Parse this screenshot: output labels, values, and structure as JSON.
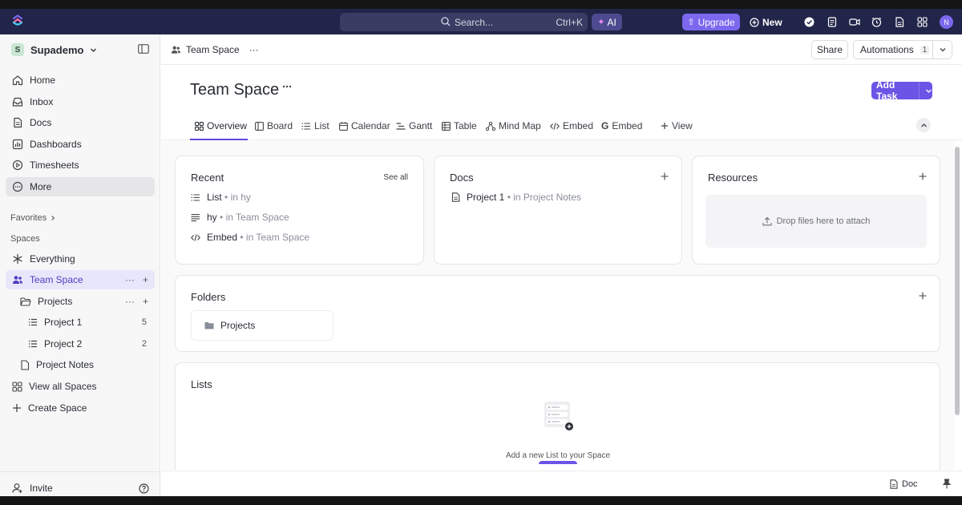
{
  "topbar": {
    "search_placeholder": "Search...",
    "search_shortcut": "Ctrl+K",
    "ai_label": "AI",
    "upgrade_label": "Upgrade",
    "new_label": "New",
    "avatar_initial": "N",
    "colors": {
      "bar": "#22254a",
      "accent": "#7b68ee"
    }
  },
  "sidebar": {
    "workspace_initial": "S",
    "workspace_name": "Supademo",
    "nav": [
      {
        "label": "Home",
        "icon": "home-icon"
      },
      {
        "label": "Inbox",
        "icon": "inbox-icon"
      },
      {
        "label": "Docs",
        "icon": "docs-icon"
      },
      {
        "label": "Dashboards",
        "icon": "dashboards-icon"
      },
      {
        "label": "Timesheets",
        "icon": "timesheets-icon"
      },
      {
        "label": "More",
        "icon": "more-icon"
      }
    ],
    "favorites_label": "Favorites",
    "spaces_label": "Spaces",
    "spaces": [
      {
        "label": "Everything",
        "icon": "everything-icon"
      },
      {
        "label": "Team Space",
        "icon": "team-icon"
      },
      {
        "label": "Projects",
        "icon": "folder-open-icon"
      },
      {
        "label": "Project 1",
        "count": "5",
        "icon": "list-icon"
      },
      {
        "label": "Project 2",
        "count": "2",
        "icon": "list-icon"
      },
      {
        "label": "Project Notes",
        "icon": "doc-icon"
      },
      {
        "label": "View all Spaces",
        "icon": "grid-icon"
      },
      {
        "label": "Create Space",
        "icon": "plus-icon"
      }
    ],
    "invite_label": "Invite"
  },
  "header": {
    "breadcrumb": "Team Space",
    "share_label": "Share",
    "automations_label": "Automations",
    "automations_count": "1"
  },
  "page": {
    "title": "Team Space",
    "add_task_label": "Add Task"
  },
  "tabs": [
    {
      "label": "Overview",
      "icon": "overview-icon"
    },
    {
      "label": "Board",
      "icon": "board-icon"
    },
    {
      "label": "List",
      "icon": "list-icon"
    },
    {
      "label": "Calendar",
      "icon": "calendar-icon"
    },
    {
      "label": "Gantt",
      "icon": "gantt-icon"
    },
    {
      "label": "Table",
      "icon": "table-icon"
    },
    {
      "label": "Mind Map",
      "icon": "mindmap-icon"
    },
    {
      "label": "Embed",
      "icon": "embed-icon"
    },
    {
      "label": "Embed",
      "icon": "google-icon"
    },
    {
      "label": "View",
      "icon": "plus-icon"
    }
  ],
  "recent": {
    "title": "Recent",
    "see_all": "See all",
    "items": [
      {
        "name": "List",
        "location": "• in hy",
        "icon": "list-icon"
      },
      {
        "name": "hy",
        "location": "• in Team Space",
        "icon": "lines-icon"
      },
      {
        "name": "Embed",
        "location": "• in Team Space",
        "icon": "embed-icon"
      }
    ]
  },
  "docs": {
    "title": "Docs",
    "items": [
      {
        "name": "Project 1",
        "location": "• in Project Notes",
        "icon": "doc-icon"
      }
    ]
  },
  "resources": {
    "title": "Resources",
    "drop_text": "Drop files here to attach"
  },
  "folders": {
    "title": "Folders",
    "items": [
      {
        "name": "Projects"
      }
    ]
  },
  "lists": {
    "title": "Lists",
    "empty_text": "Add a new List to your Space"
  },
  "footer": {
    "doc_label": "Doc"
  }
}
